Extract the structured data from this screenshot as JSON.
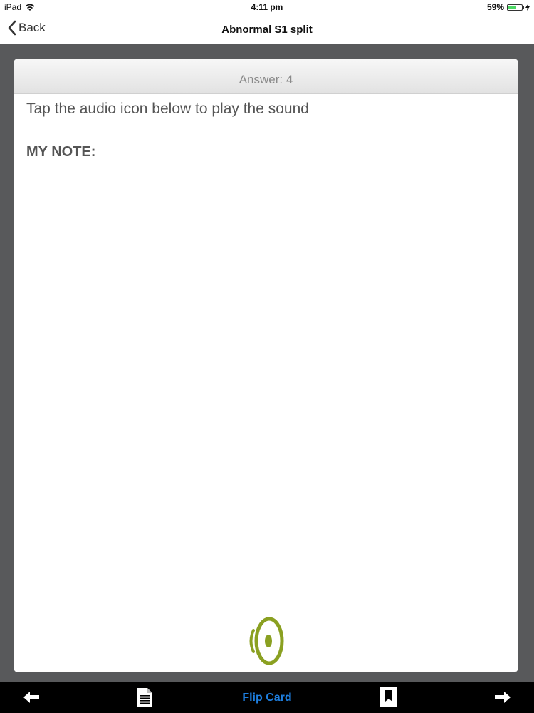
{
  "status_bar": {
    "device": "iPad",
    "time": "4:11 pm",
    "battery": "59%",
    "battery_level": 0.59,
    "icons": [
      "wifi-icon",
      "battery-icon",
      "charging-bolt-icon"
    ]
  },
  "nav": {
    "back_label": "Back",
    "title": "Abnormal S1  split"
  },
  "card": {
    "answer": "Answer: 4",
    "instructions": "Tap the audio icon below to play the sound",
    "note_label": "MY NOTE:",
    "audio_icon": "speaker-audio-icon",
    "audio_color": "#8aa021"
  },
  "toolbar": {
    "flip_label": "Flip Card",
    "icons": [
      "arrow-left-icon",
      "document-icon",
      "bookmark-icon",
      "arrow-right-icon"
    ],
    "accent": "#1e7fe0"
  }
}
